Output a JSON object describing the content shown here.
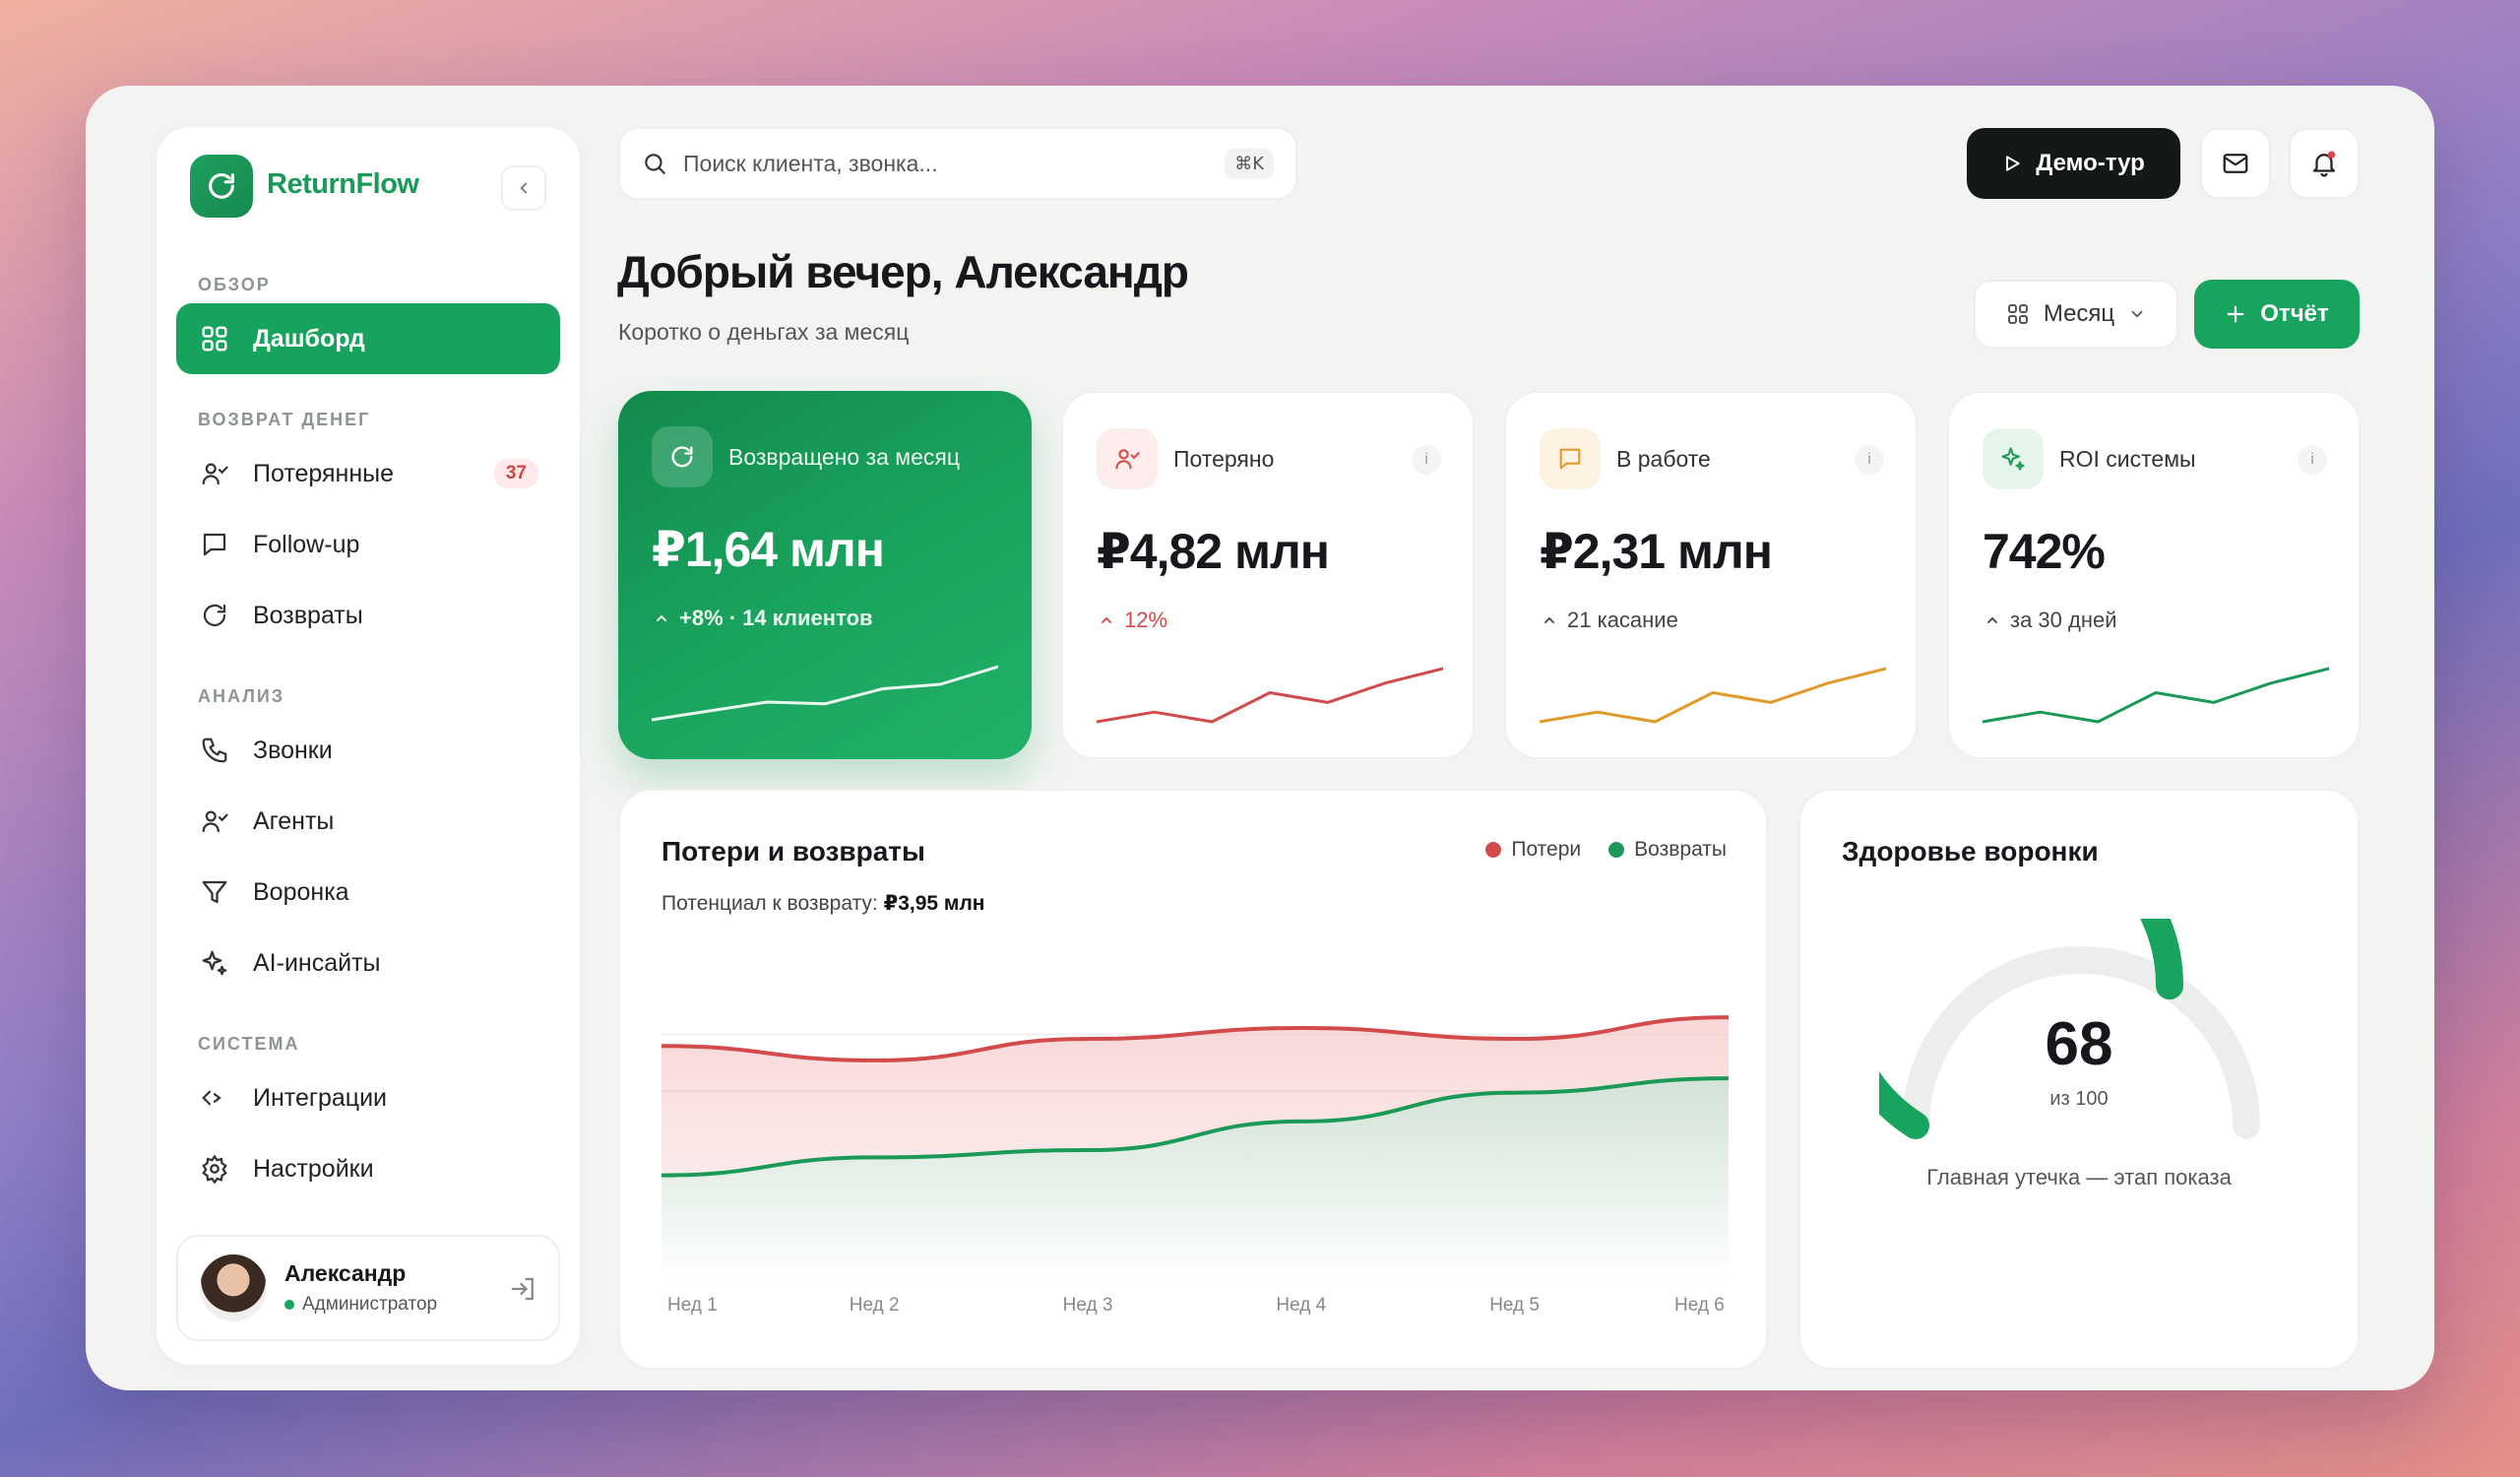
{
  "brand": {
    "name": "ReturnFlow"
  },
  "sidebar": {
    "sections": [
      {
        "title": "ОБЗОР"
      },
      {
        "title": "ВОЗВРАТ ДЕНЕГ"
      },
      {
        "title": "АНАЛИЗ"
      },
      {
        "title": "СИСТЕМА"
      }
    ],
    "items": [
      {
        "label": "Дашборд",
        "icon": "grid-icon",
        "active": true
      },
      {
        "label": "Потерянные",
        "icon": "user-lost-icon",
        "badge": "37"
      },
      {
        "label": "Follow-up",
        "icon": "message-icon"
      },
      {
        "label": "Возвраты",
        "icon": "refresh-icon"
      },
      {
        "label": "Звонки",
        "icon": "phone-icon"
      },
      {
        "label": "Агенты",
        "icon": "user-check-icon"
      },
      {
        "label": "Воронка",
        "icon": "filter-icon"
      },
      {
        "label": "AI-инсайты",
        "icon": "sparkle-icon"
      },
      {
        "label": "Интеграции",
        "icon": "code-icon"
      },
      {
        "label": "Настройки",
        "icon": "gear-icon"
      }
    ],
    "user": {
      "name": "Александр",
      "role": "Администратор"
    }
  },
  "topbar": {
    "search_placeholder": "Поиск клиента, звонка...",
    "shortcut": "⌘K",
    "demo_label": "Демо-тур"
  },
  "header": {
    "greeting": "Добрый вечер, Александр",
    "subtitle": "Коротко о деньгах за месяц",
    "period_label": "Месяц",
    "report_label": "Отчёт"
  },
  "kpis": [
    {
      "label": "Возвращено за месяц",
      "value": "₽1,64 млн",
      "sub": "+8% · 14 клиентов",
      "trend": [
        2,
        3,
        4,
        3.8,
        5.5,
        6,
        8
      ],
      "color": "#ffffff"
    },
    {
      "label": "Потеряно",
      "value": "₽4,82 млн",
      "sub": "12%",
      "trend": [
        2,
        3,
        2,
        5,
        4,
        6,
        7.5
      ],
      "color": "#d24a4a"
    },
    {
      "label": "В работе",
      "value": "₽2,31 млн",
      "sub": "21 касание",
      "trend": [
        2,
        3,
        2,
        5,
        4,
        6,
        7.5
      ],
      "color": "#e09a2c"
    },
    {
      "label": "ROI системы",
      "value": "742%",
      "sub": "за 30 дней",
      "trend": [
        2,
        3,
        2,
        5,
        4,
        6,
        7.5
      ],
      "color": "#1b9a57"
    }
  ],
  "colors": {
    "accent": "#18a35e",
    "loss": "#d24a4a",
    "return": "#1b9a57"
  },
  "chart_card": {
    "title": "Потери и возвраты",
    "potential_label": "Потенциал к возврату:",
    "potential_value": "₽3,95 млн",
    "legend": [
      "Потери",
      "Возвраты"
    ]
  },
  "chart_data": {
    "type": "area",
    "categories": [
      "Нед 1",
      "Нед 2",
      "Нед 3",
      "Нед 4",
      "Нед 5",
      "Нед 6"
    ],
    "series": [
      {
        "name": "Потери",
        "values": [
          66,
          62,
          68,
          71,
          68,
          74
        ]
      },
      {
        "name": "Возвраты",
        "values": [
          30,
          35,
          37,
          45,
          53,
          57
        ]
      }
    ],
    "ylim": [
      0,
      85
    ],
    "grid": true
  },
  "gauge": {
    "title": "Здоровье воронки",
    "value": 68,
    "max": 100,
    "of_label": "из 100",
    "note": "Главная утечка — этап показа"
  }
}
